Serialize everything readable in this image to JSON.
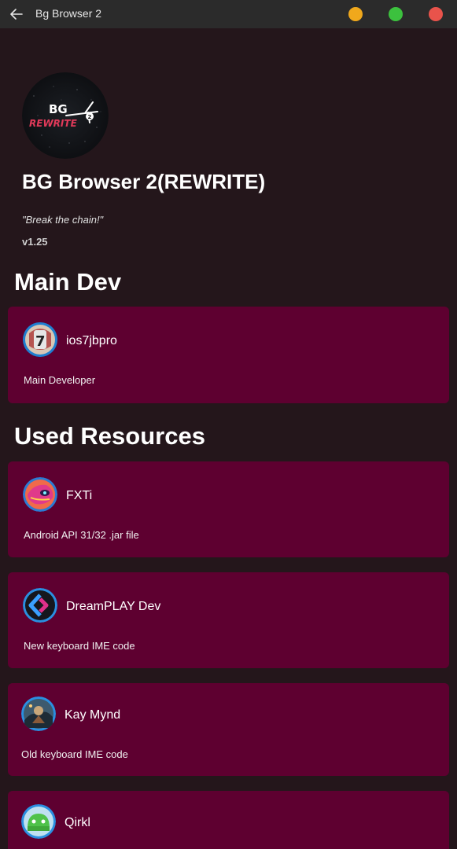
{
  "window": {
    "title": "Bg Browser 2",
    "back_icon": "arrow-left-icon",
    "controls": {
      "minimize_color": "#f0a81c",
      "maximize_color": "#3cc13e",
      "close_color": "#e9534b"
    }
  },
  "colors": {
    "background": "#24161b",
    "titlebar": "#2b2b2b",
    "card": "#5e0030"
  },
  "app": {
    "logo_icon": "bg-rewrite-logo",
    "logo_text_top": "BG",
    "logo_text_bottom": "REWRITE",
    "logo_badge": "2",
    "name": "BG Browser 2(REWRITE)",
    "tagline": "\"Break the chain!\"",
    "version": "v1.25"
  },
  "main_dev": {
    "heading": "Main Dev",
    "cards": [
      {
        "name": "ios7jbpro",
        "description": "Main Developer",
        "avatar_icon": "ios7jbpro-avatar"
      }
    ]
  },
  "used_resources": {
    "heading": "Used Resources",
    "cards": [
      {
        "name": "FXTi",
        "description": "Android API 31/32 .jar file",
        "avatar_icon": "fxti-avatar"
      },
      {
        "name": "DreamPLAY Dev",
        "description": "New keyboard IME code",
        "avatar_icon": "dreamplay-avatar"
      },
      {
        "name": "Kay Mynd",
        "description": "Old keyboard IME code",
        "avatar_icon": "kay-mynd-avatar"
      },
      {
        "name": "Qirkl",
        "description": "",
        "avatar_icon": "qirkl-avatar"
      }
    ]
  }
}
